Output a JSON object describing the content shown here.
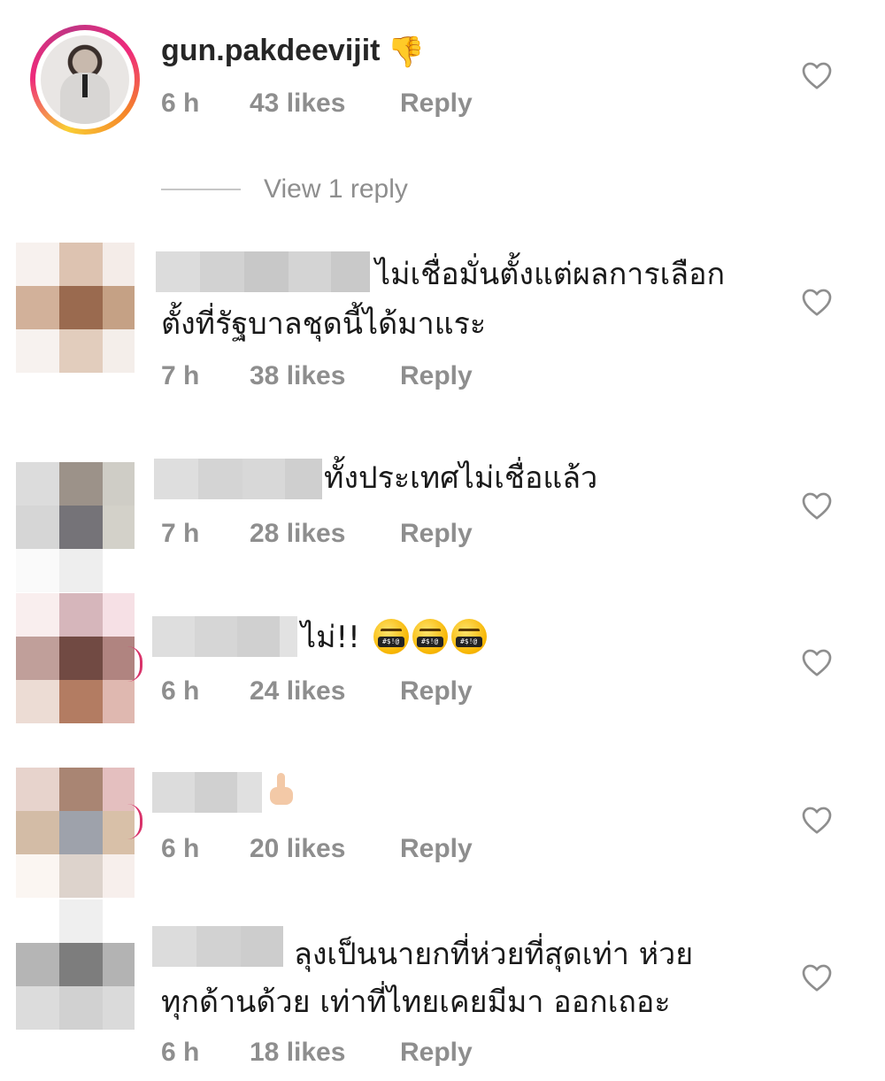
{
  "comments": [
    {
      "username": "gun.pakdeevijit",
      "emoji": "👎",
      "time": "6 h",
      "likes": "43 likes",
      "reply": "Reply",
      "view_replies": "View 1 reply"
    },
    {
      "line1": "ไม่เชื่อมั่นตั้งแต่ผลการเลือก",
      "line2": "ตั้งที่รัฐบาลชุดนี้ได้มาแระ",
      "time": "7 h",
      "likes": "38 likes",
      "reply": "Reply"
    },
    {
      "line1": "ทั้งประเทศไม่เชื่อแล้ว",
      "time": "7 h",
      "likes": "28 likes",
      "reply": "Reply"
    },
    {
      "line1": "ไม่!!",
      "emoji_name": "face-with-symbols-on-mouth",
      "emoji_count": 3,
      "time": "6 h",
      "likes": "24 likes",
      "reply": "Reply"
    },
    {
      "emoji_name": "middle-finger",
      "time": "6 h",
      "likes": "20 likes",
      "reply": "Reply"
    },
    {
      "line1": "ลุงเป็นนายกที่ห่วยที่สุดเท่า ห่วย",
      "line2": "ทุกด้านด้วย เท่าที่ไทยเคยมีมา ออกเถอะ",
      "time": "6 h",
      "likes": "18 likes",
      "reply": "Reply"
    }
  ],
  "colors": {
    "meta_gray": "#8e8e8e",
    "text": "#1a1a1a",
    "story_ring_pink": "#ee2a7b",
    "story_ring_yellow": "#f9ce34"
  }
}
